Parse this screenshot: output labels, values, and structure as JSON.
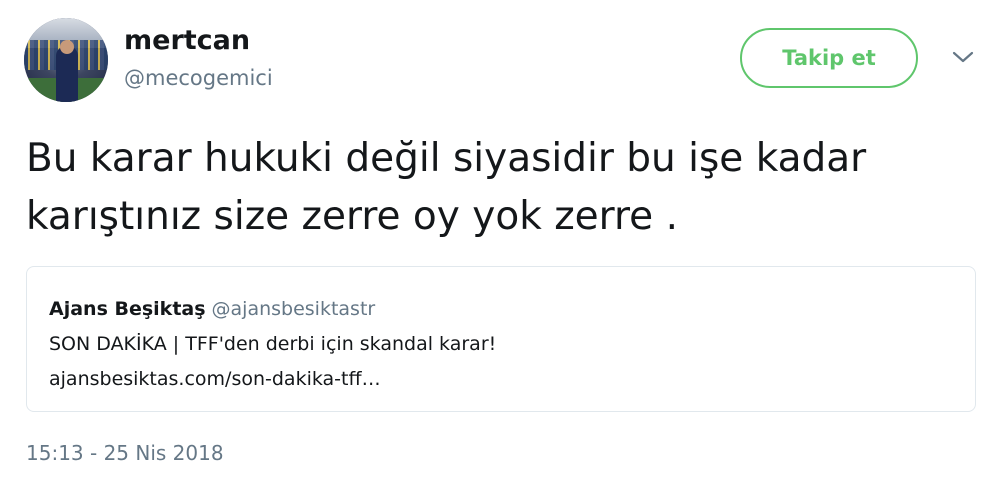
{
  "user": {
    "name": "mertcan",
    "handle": "@mecogemici",
    "avatar_icon": "profile-photo"
  },
  "actions": {
    "follow_label": "Takip et",
    "menu_icon": "chevron-down-icon"
  },
  "tweet": {
    "text_line1": "Bu karar hukuki değil siyasidir bu işe kadar",
    "text_line2": "karıştınız size zerre oy yok zerre .",
    "timestamp": "15:13 - 25 Nis 2018"
  },
  "quoted": {
    "name": "Ajans Beşiktaş",
    "handle": "@ajansbesiktastr",
    "text": "SON DAKİKA | TFF'den derbi için skandal karar!",
    "link": "ajansbesiktas.com/son-dakika-tff…"
  },
  "colors": {
    "follow_green": "#5fc66c",
    "secondary_text": "#657786",
    "border": "#e1e8ed"
  }
}
